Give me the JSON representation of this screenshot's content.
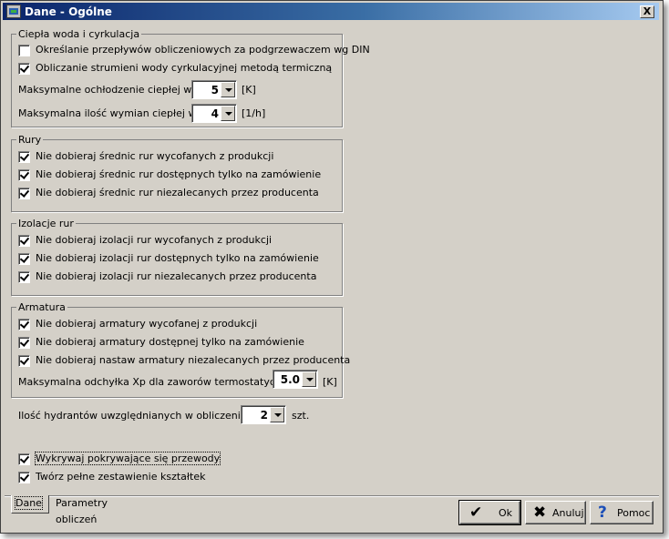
{
  "window": {
    "title": "Dane - Ogólne",
    "close_glyph": "X",
    "icon": "app-icon"
  },
  "hot_water": {
    "legend": "Ciepła woda i cyrkulacja",
    "checks": [
      {
        "label": "Określanie przepływów obliczeniowych za podgrzewaczem  wg DIN",
        "checked": false
      },
      {
        "label": "Obliczanie strumieni wody cyrkulacyjnej metodą termiczną",
        "checked": true
      }
    ],
    "max_cooling": {
      "label": "Maksymalne ochłodzenie ciepłej wody",
      "value": "5",
      "unit": "[K]"
    },
    "max_exchanges": {
      "label": "Maksymalna ilość wymian ciepłej wody",
      "value": "4",
      "unit": "[1/h]"
    }
  },
  "pipes": {
    "legend": "Rury",
    "checks": [
      {
        "label": "Nie dobieraj średnic rur wycofanych z produkcji",
        "checked": true
      },
      {
        "label": "Nie dobieraj średnic rur dostępnych tylko na zamówienie",
        "checked": true
      },
      {
        "label": "Nie dobieraj średnic rur niezalecanych przez producenta",
        "checked": true
      }
    ]
  },
  "insulation": {
    "legend": "Izolacje rur",
    "checks": [
      {
        "label": "Nie dobieraj izolacji rur wycofanych z produkcji",
        "checked": true
      },
      {
        "label": "Nie dobieraj izolacji rur dostępnych tylko na zamówienie",
        "checked": true
      },
      {
        "label": "Nie dobieraj izolacji rur niezalecanych przez producenta",
        "checked": true
      }
    ]
  },
  "fittings": {
    "legend": "Armatura",
    "checks": [
      {
        "label": "Nie dobieraj armatury wycofanej z produkcji",
        "checked": true
      },
      {
        "label": "Nie dobieraj armatury dostępnej tylko na zamówienie",
        "checked": true
      },
      {
        "label": "Nie dobieraj nastaw armatury niezalecanych przez producenta",
        "checked": true
      }
    ],
    "xp": {
      "label": "Maksymalna odchyłka Xp dla zaworów termostatycznych",
      "value": "5.0",
      "unit": "[K]"
    }
  },
  "hydrants": {
    "label": "Ilość hydrantów uwzględnianych w obliczeniach",
    "value": "2",
    "unit": "szt."
  },
  "options": [
    {
      "label": "Wykrywaj pokrywające się przewody",
      "checked": true
    },
    {
      "label": "Twórz pełne zestawienie kształtek",
      "checked": true
    }
  ],
  "tabs": [
    {
      "label": "Dane"
    },
    {
      "label": "Parametry obliczeń"
    }
  ],
  "buttons": {
    "ok": {
      "label": "Ok",
      "icon": "checkmark-icon"
    },
    "cancel": {
      "label": "Anuluj",
      "icon": "x-cross-icon"
    },
    "help": {
      "label": "Pomoc",
      "icon": "question-icon"
    }
  }
}
